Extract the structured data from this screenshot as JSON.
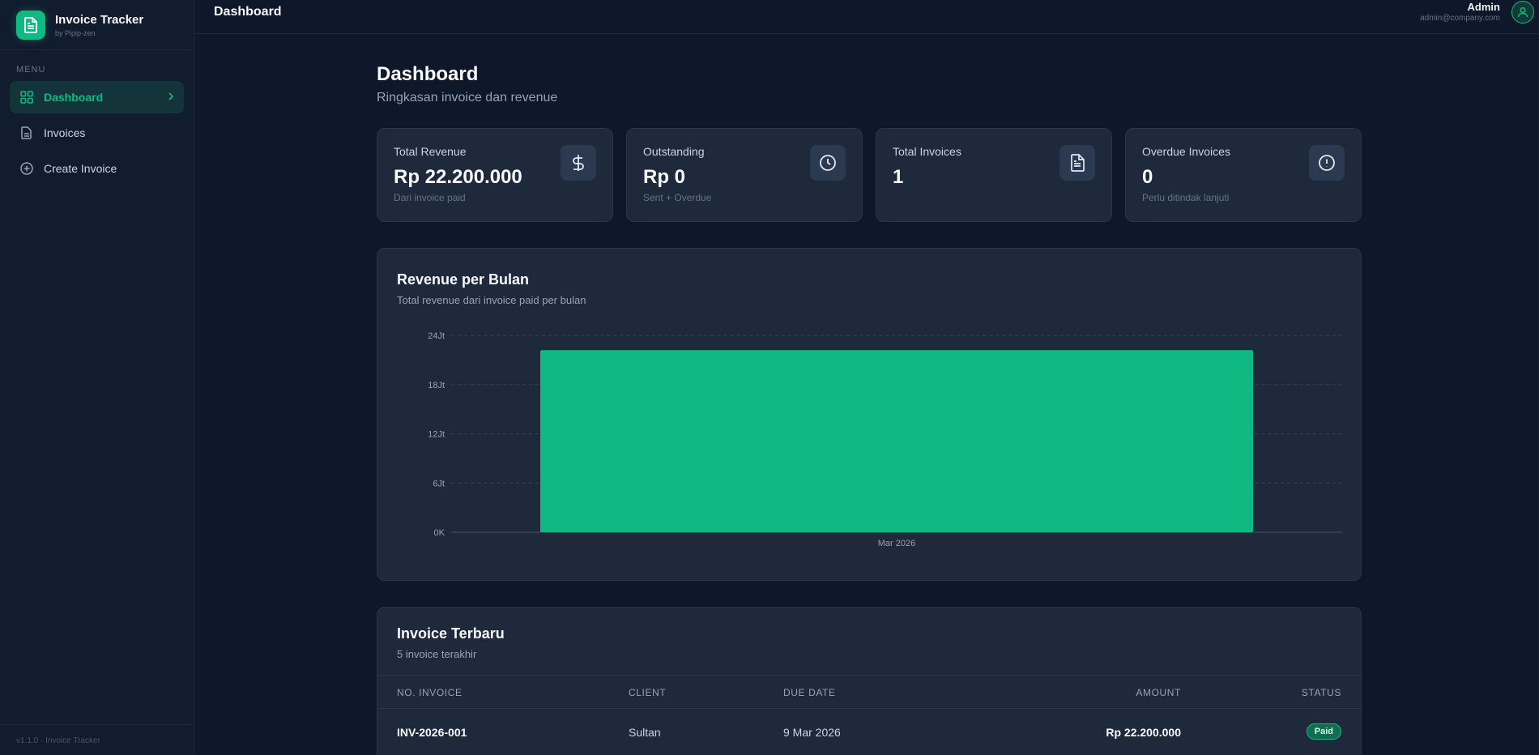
{
  "brand": {
    "title": "Invoice Tracker",
    "subtitle": "by Pipip-zen"
  },
  "sidebar": {
    "menu_label": "MENU",
    "items": [
      {
        "label": "Dashboard",
        "icon": "grid-icon",
        "active": true
      },
      {
        "label": "Invoices",
        "icon": "file-icon",
        "active": false
      },
      {
        "label": "Create Invoice",
        "icon": "plus-circle-icon",
        "active": false
      }
    ],
    "footer": "v1.1.0 · Invoice Tracker"
  },
  "topbar": {
    "title": "Dashboard",
    "user_name": "Admin",
    "user_email": "admin@company.com"
  },
  "page": {
    "title": "Dashboard",
    "subtitle": "Ringkasan invoice dan revenue"
  },
  "stats": [
    {
      "label": "Total Revenue",
      "value": "Rp 22.200.000",
      "note": "Dari invoice paid",
      "icon": "dollar-icon"
    },
    {
      "label": "Outstanding",
      "value": "Rp 0",
      "note": "Sent + Overdue",
      "icon": "clock-icon"
    },
    {
      "label": "Total Invoices",
      "value": "1",
      "note": "",
      "icon": "document-icon"
    },
    {
      "label": "Overdue Invoices",
      "value": "0",
      "note": "Perlu ditindak lanjuti",
      "icon": "alert-icon"
    }
  ],
  "chart_card": {
    "title": "Revenue per Bulan",
    "subtitle": "Total revenue dari invoice paid per bulan"
  },
  "chart_data": {
    "type": "bar",
    "categories": [
      "Mar 2026"
    ],
    "values": [
      22200000
    ],
    "ylim": [
      0,
      24000000
    ],
    "yticks": [
      0,
      6000000,
      12000000,
      18000000,
      24000000
    ],
    "ytick_labels": [
      "0K",
      "6Jt",
      "12Jt",
      "18Jt",
      "24Jt"
    ],
    "grid": true,
    "bar_color": "#10b981"
  },
  "recent": {
    "title": "Invoice Terbaru",
    "subtitle": "5 invoice terakhir",
    "columns": [
      "NO. INVOICE",
      "CLIENT",
      "DUE DATE",
      "AMOUNT",
      "STATUS"
    ],
    "rows": [
      {
        "no": "INV-2026-001",
        "client": "Sultan",
        "due": "9 Mar 2026",
        "amount": "Rp 22.200.000",
        "status": "Paid"
      }
    ]
  },
  "colors": {
    "accent": "#10b981",
    "background": "#0f172a",
    "card": "#1e293b"
  }
}
